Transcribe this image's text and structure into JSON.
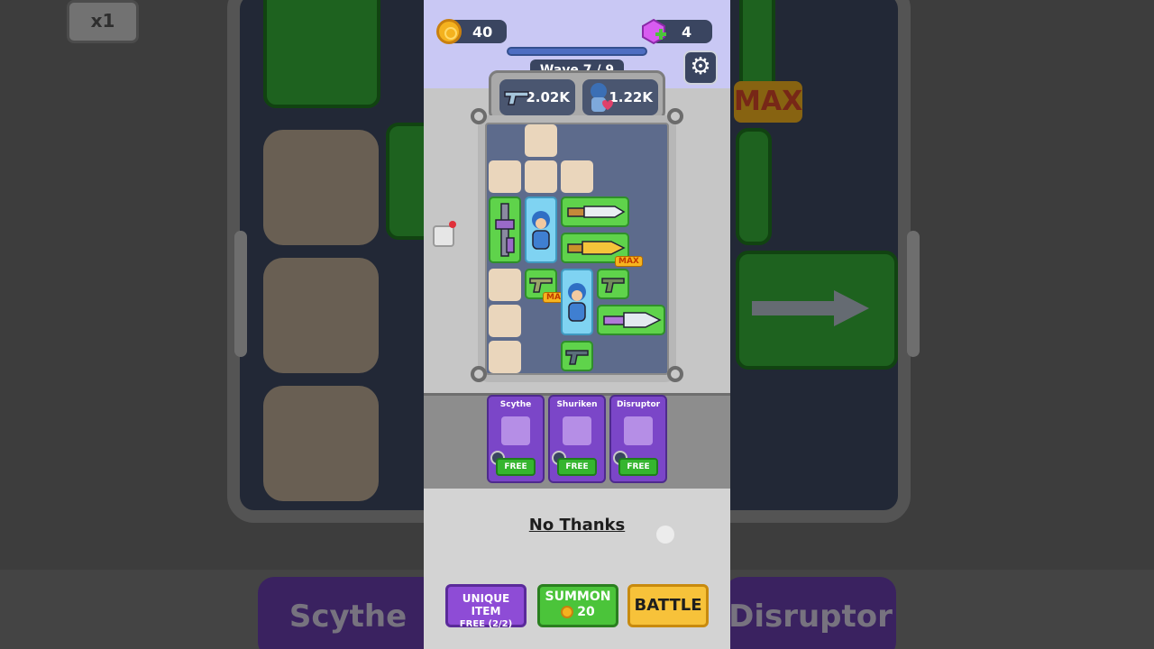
{
  "hud": {
    "coins": "40",
    "gems": "4",
    "wave": "Wave 7 / 9",
    "wave_progress": 0.78
  },
  "stats": {
    "attack": "2.02K",
    "health": "1.22K"
  },
  "board_tiles": {
    "max_tag": "MAX"
  },
  "offers": [
    {
      "name": "Scythe",
      "price": "FREE"
    },
    {
      "name": "Shuriken",
      "price": "FREE"
    },
    {
      "name": "Disruptor",
      "price": "FREE"
    }
  ],
  "no_thanks": "No Thanks",
  "buttons": {
    "unique_item": "UNIQUE ITEM",
    "unique_item_sub": "FREE (2/2)",
    "summon": "SUMMON",
    "summon_cost": "20",
    "battle": "BATTLE"
  },
  "background": {
    "left_card": "Scythe",
    "right_card": "Disruptor",
    "right_max": "MAX",
    "speed": "x1"
  },
  "colors": {
    "card_purple": "#7b46c8",
    "tile_green": "#5fd34b",
    "tile_blue": "#7fd3f2",
    "battle_yellow": "#f7c23a",
    "summon_green": "#4bc43a"
  }
}
